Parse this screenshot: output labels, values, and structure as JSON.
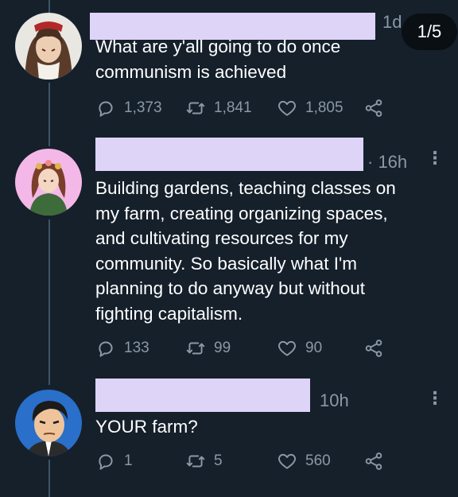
{
  "page_indicator": "1/5",
  "tweets": [
    {
      "time": "1d",
      "text": "What are y'all going to do once\ncommunism is achieved",
      "replies": "1,373",
      "retweets": "1,841",
      "likes": "1,805"
    },
    {
      "time": "· 16h",
      "text": "Building gardens, teaching classes on\nmy farm,  creating organizing spaces,\nand cultivating resources for my\ncommunity. So basically what I'm\nplanning to do anyway but without\nfighting capitalism.",
      "replies": "133",
      "retweets": "99",
      "likes": "90"
    },
    {
      "time": "10h",
      "text": "YOUR farm?",
      "replies": "1",
      "retweets": "5",
      "likes": "560"
    }
  ],
  "icons": {
    "reply": "reply-icon",
    "retweet": "retweet-icon",
    "like": "heart-icon",
    "share": "share-icon",
    "more": "more-icon"
  },
  "colors": {
    "background": "#15202b",
    "text": "#ffffff",
    "muted": "#8b98a5",
    "thread_line": "#3d5466",
    "redaction": "#ddd4f8"
  }
}
